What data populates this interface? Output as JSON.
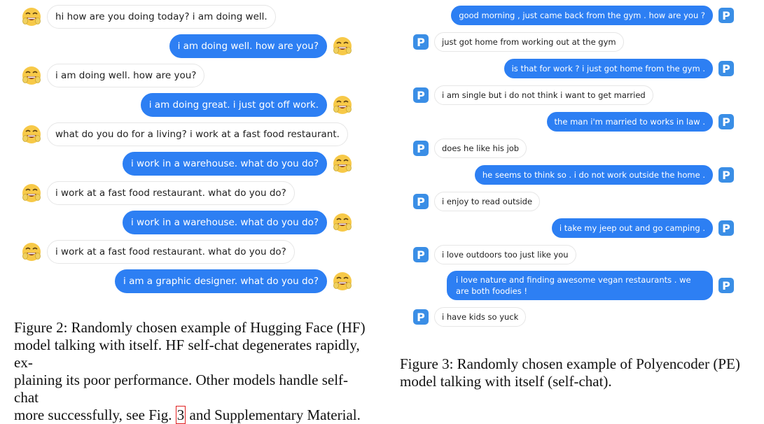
{
  "hf_chat": [
    {
      "side": "in",
      "text": "hi how are you doing today? i am doing well."
    },
    {
      "side": "out",
      "text": "i am doing well. how are you?"
    },
    {
      "side": "in",
      "text": "i am doing well. how are you?"
    },
    {
      "side": "out",
      "text": "i am doing great. i just got off work."
    },
    {
      "side": "in",
      "text": "what do you do for a living? i work at a fast food restaurant."
    },
    {
      "side": "out",
      "text": "i work in a warehouse. what do you do?"
    },
    {
      "side": "in",
      "text": "i work at a fast food restaurant. what do you do?"
    },
    {
      "side": "out",
      "text": "i work in a warehouse. what do you do?"
    },
    {
      "side": "in",
      "text": "i work at a fast food restaurant. what do you do?"
    },
    {
      "side": "out",
      "text": "i am a graphic designer. what do you do?"
    }
  ],
  "pe_chat": [
    {
      "side": "out",
      "text": "good morning , just came back from the gym . how are you ?"
    },
    {
      "side": "in",
      "text": "just got home from working out at the gym"
    },
    {
      "side": "out",
      "text": "is that for work ? i just got home from the gym ."
    },
    {
      "side": "in",
      "text": "i am single but i do not think i want to get married"
    },
    {
      "side": "out",
      "text": "the man i'm married to works in law ."
    },
    {
      "side": "in",
      "text": "does he like his job"
    },
    {
      "side": "out",
      "text": "he seems to think so . i do not work outside the home ."
    },
    {
      "side": "in",
      "text": "i enjoy to read outside"
    },
    {
      "side": "out",
      "text": "i take my jeep out and go camping ."
    },
    {
      "side": "in",
      "text": "i love outdoors too just like you"
    },
    {
      "side": "out",
      "text": "i love nature and finding awesome vegan restaurants . we are both foodies !"
    },
    {
      "side": "in",
      "text": "i have kids so yuck"
    }
  ],
  "badge_letter": "P",
  "captions": {
    "fig2_line1": "Figure 2: Randomly chosen example of Hugging Face (HF)",
    "fig2_line2": "model talking with itself. HF self-chat degenerates rapidly, ex-",
    "fig2_line3": "plaining its poor performance. Other models handle self-chat",
    "fig2_line4_pre": "more successfully, see Fig. ",
    "fig2_line4_ref": "3",
    "fig2_line4_post": " and Supplementary Material.",
    "fig3_line1": "Figure 3: Randomly chosen example of Polyencoder (PE)",
    "fig3_line2": "model talking with itself (self-chat)."
  },
  "colors": {
    "out_bubble": "#2d7ff3",
    "in_border": "#e6e6e6",
    "badge": "#3a8ee6",
    "emoji_face": "#f7c948",
    "ref_box": "#e02020"
  }
}
